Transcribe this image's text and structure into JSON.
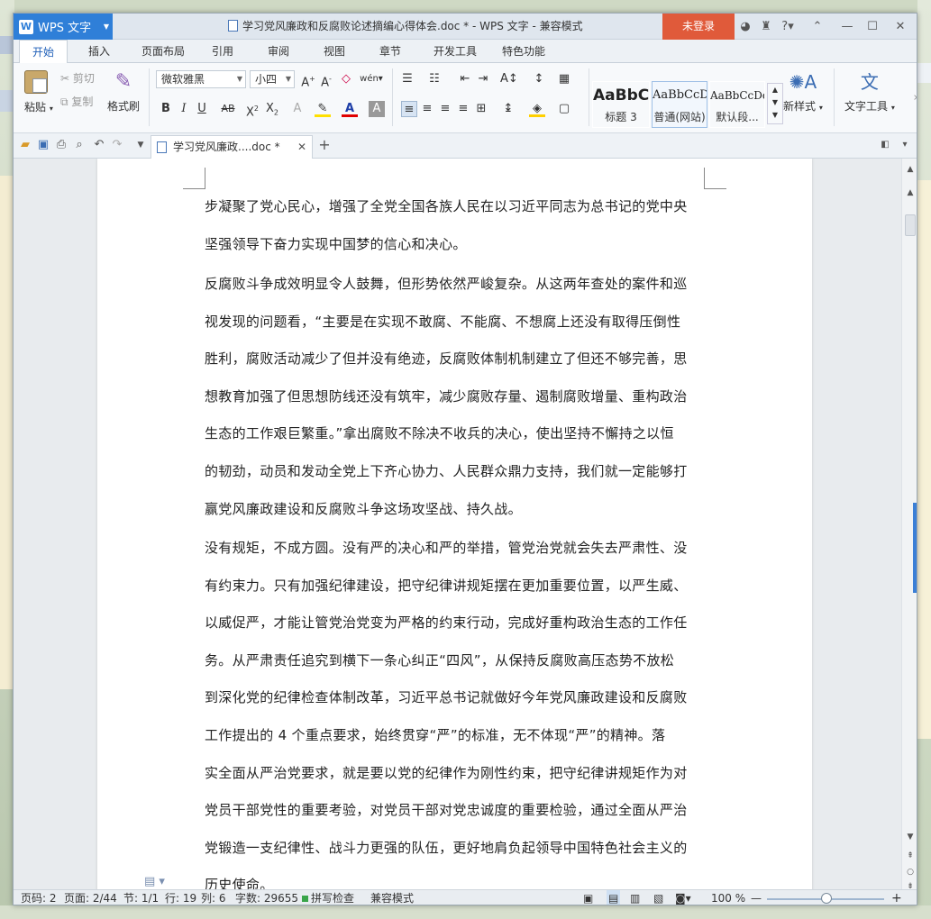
{
  "app": {
    "name": "WPS 文字",
    "window_title": "学习党风廉政和反腐败论述摘编心得体会.doc * - WPS 文字 - 兼容模式",
    "login_label": "未登录",
    "help_label": "?"
  },
  "menu": {
    "tabs": [
      "开始",
      "插入",
      "页面布局",
      "引用",
      "审阅",
      "视图",
      "章节",
      "开发工具",
      "特色功能"
    ],
    "active": "开始"
  },
  "ribbon": {
    "paste": "粘贴",
    "cut": "剪切",
    "copy": "复制",
    "format_painter": "格式刷",
    "font_name": "微软雅黑",
    "font_size": "小四",
    "styles": [
      {
        "sample": "AaBbC",
        "name": "标题 3"
      },
      {
        "sample": "AaBbCcD",
        "name": "普通(网站)"
      },
      {
        "sample": "AaBbCcDd",
        "name": "默认段..."
      }
    ],
    "new_style": "新样式",
    "text_tools": "文字工具"
  },
  "doc_tab": {
    "label": "学习党风廉政....doc *"
  },
  "document": {
    "paragraphs": [
      [
        "步凝聚了党心民心，增强了全党全国各族人民在以习近平同志为总书记的党中央",
        "坚强领导下奋力实现中国梦的信心和决心。"
      ],
      [
        "反腐败斗争成效明显令人鼓舞，但形势依然严峻复杂。从这两年查处的案件和巡",
        "视发现的问题看，“主要是在实现不敢腐、不能腐、不想腐上还没有取得压倒性",
        "胜利，腐败活动减少了但并没有绝迹，反腐败体制机制建立了但还不够完善，思",
        "想教育加强了但思想防线还没有筑牢，减少腐败存量、遏制腐败增量、重构政治",
        "生态的工作艰巨繁重。”拿出腐败不除决不收兵的决心，使出坚持不懈持之以恒",
        "的韧劲，动员和发动全党上下齐心协力、人民群众鼎力支持，我们就一定能够打",
        "赢党风廉政建设和反腐败斗争这场攻坚战、持久战。"
      ],
      [
        "没有规矩，不成方圆。没有严的决心和严的举措，管党治党就会失去严肃性、没",
        "有约束力。只有加强纪律建设，把守纪律讲规矩摆在更加重要位置，以严生威、",
        "以威促严，才能让管党治党变为严格的约束行动，完成好重构政治生态的工作任",
        "务。从严肃责任追究到横下一条心纠正“四风”，从保持反腐败高压态势不放松",
        "到深化党的纪律检查体制改革，习近平总书记就做好今年党风廉政建设和反腐败",
        "工作提出的 4 个重点要求，始终贯穿“严”的标准，无不体现“严”的精神。落",
        "实全面从严治党要求，就是要以党的纪律作为刚性约束，把守纪律讲规矩作为对",
        "党员干部党性的重要考验，对党员干部对党忠诚度的重要检验，通过全面从严治",
        "党锻造一支纪律性、战斗力更强的队伍，更好地肩负起领导中国特色社会主义的",
        "历史使命。"
      ]
    ]
  },
  "status": {
    "page_no": "页码: 2",
    "pages": "页面: 2/44",
    "section": "节: 1/1",
    "row": "行: 19",
    "col": "列: 6",
    "words": "字数: 29655",
    "spell": "拼写检查",
    "mode": "兼容模式",
    "zoom": "100 %"
  },
  "colors": {
    "brand_blue": "#2f7fd8",
    "login_red": "#e05a3a",
    "spell_green": "#3aa54a"
  }
}
